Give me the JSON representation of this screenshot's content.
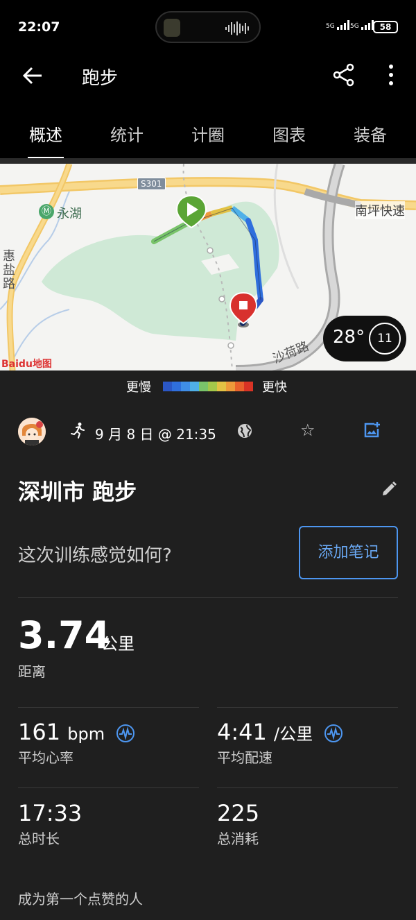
{
  "status": {
    "time": "22:07",
    "signal1": "5G",
    "signal2": "5G",
    "battery": "58"
  },
  "appbar": {
    "title": "跑步"
  },
  "tabs": [
    "概述",
    "统计",
    "计圈",
    "图表",
    "装备"
  ],
  "map": {
    "road_label": "S301",
    "station": "永湖",
    "road_left": "惠盐路",
    "road_right": "南坪快速",
    "road_bottom": "沙荷路",
    "brand": "Baidu地图"
  },
  "weather": {
    "temp": "28°",
    "wind": "11"
  },
  "legend": {
    "slow": "更慢",
    "fast": "更快",
    "colors": [
      "#2b57c6",
      "#2f6fdd",
      "#3f8ee8",
      "#4fb0e8",
      "#79c46a",
      "#a4c84a",
      "#e3c244",
      "#ee9a3a",
      "#e9622c",
      "#d93325"
    ]
  },
  "meta": {
    "date": "9 月 8 日 @ 21:35"
  },
  "activity": {
    "title": "深圳市 跑步",
    "feel_prompt": "这次训练感觉如何?",
    "note_button": "添加笔记"
  },
  "distance": {
    "value": "3.74",
    "unit": "公里",
    "label": "距离"
  },
  "stats": {
    "hr": {
      "value": "161",
      "unit": "bpm",
      "label": "平均心率"
    },
    "pace": {
      "value": "4:41",
      "unit": "/公里",
      "label": "平均配速"
    },
    "duration": {
      "value": "17:33",
      "label": "总时长"
    },
    "calories": {
      "value": "225",
      "label": "总消耗"
    }
  },
  "likes": "成为第一个点赞的人"
}
